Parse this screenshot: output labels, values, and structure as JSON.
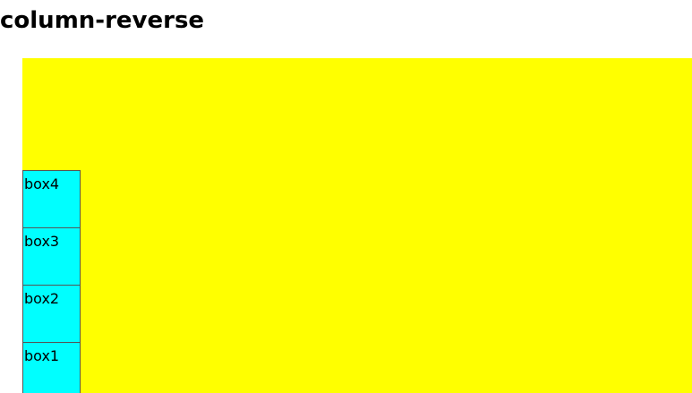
{
  "page": {
    "title": "column-reverse"
  },
  "container": {
    "background": "#ffff00",
    "boxes": [
      {
        "label": "box1"
      },
      {
        "label": "box2"
      },
      {
        "label": "box3"
      },
      {
        "label": "box4"
      }
    ],
    "box_color": "#00ffff"
  }
}
